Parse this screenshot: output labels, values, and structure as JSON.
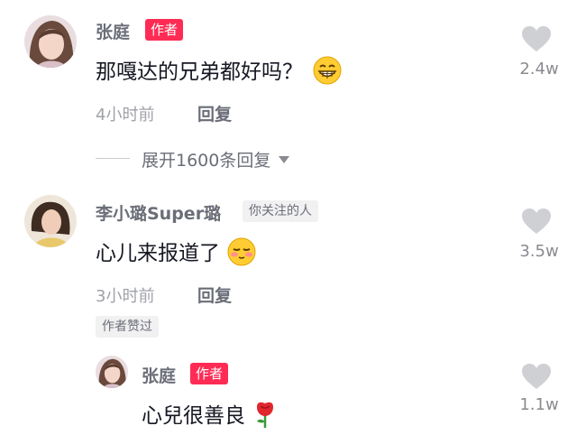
{
  "comments": [
    {
      "username": "张庭",
      "badge": "作者",
      "text": "那嘎达的兄弟都好吗？",
      "time": "4小时前",
      "reply_label": "回复",
      "likes": "2.4w",
      "expand_label": "展开1600条回复"
    },
    {
      "username": "李小璐Super璐",
      "badge": "你关注的人",
      "text": "心儿来报道了",
      "time": "3小时前",
      "reply_label": "回复",
      "likes": "3.5w",
      "liked_by_author": "作者赞过",
      "reply": {
        "username": "张庭",
        "badge": "作者",
        "text": "心兒很善良",
        "likes": "1.1w"
      }
    }
  ],
  "colors": {
    "accent": "#fe2c55",
    "heart": "#cfd0d4"
  }
}
